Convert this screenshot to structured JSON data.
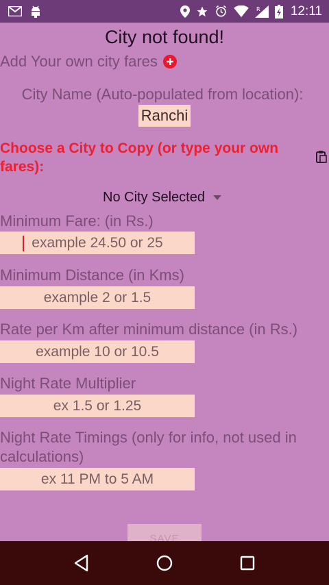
{
  "status_bar": {
    "time": "12:11",
    "left_icons": [
      "gmail-icon",
      "android-icon"
    ],
    "right_icons": [
      "location-icon",
      "star-icon",
      "alarm-icon",
      "wifi-icon",
      "signal-icon",
      "battery-icon"
    ]
  },
  "page": {
    "title": "City not found!",
    "add_label": "Add Your own city fares",
    "city_label": "City Name (Auto-populated from location):",
    "city_value": "Ranchi",
    "copy_label": "Choose a City to Copy (or type your own fares):",
    "spinner_value": "No City Selected"
  },
  "fields": [
    {
      "label": "Minimum Fare: (in Rs.)",
      "placeholder": "example 24.50 or 25"
    },
    {
      "label": "Minimum Distance (in Kms)",
      "placeholder": "example 2 or 1.5"
    },
    {
      "label": "Rate per Km after minimum distance (in Rs.)",
      "placeholder": "example 10 or 10.5"
    },
    {
      "label": "Night Rate Multiplier",
      "placeholder": "ex 1.5 or 1.25"
    },
    {
      "label": "Night Rate Timings (only for info, not used in calculations)",
      "placeholder": "ex 11 PM to 5 AM"
    }
  ],
  "save_label": "SAVE",
  "colors": {
    "background": "#c586c0",
    "status_bar": "#6d3b78",
    "accent_red": "#ef1f2f",
    "input_bg": "#fbd7c9",
    "nav_bar": "#3a0a0a"
  }
}
